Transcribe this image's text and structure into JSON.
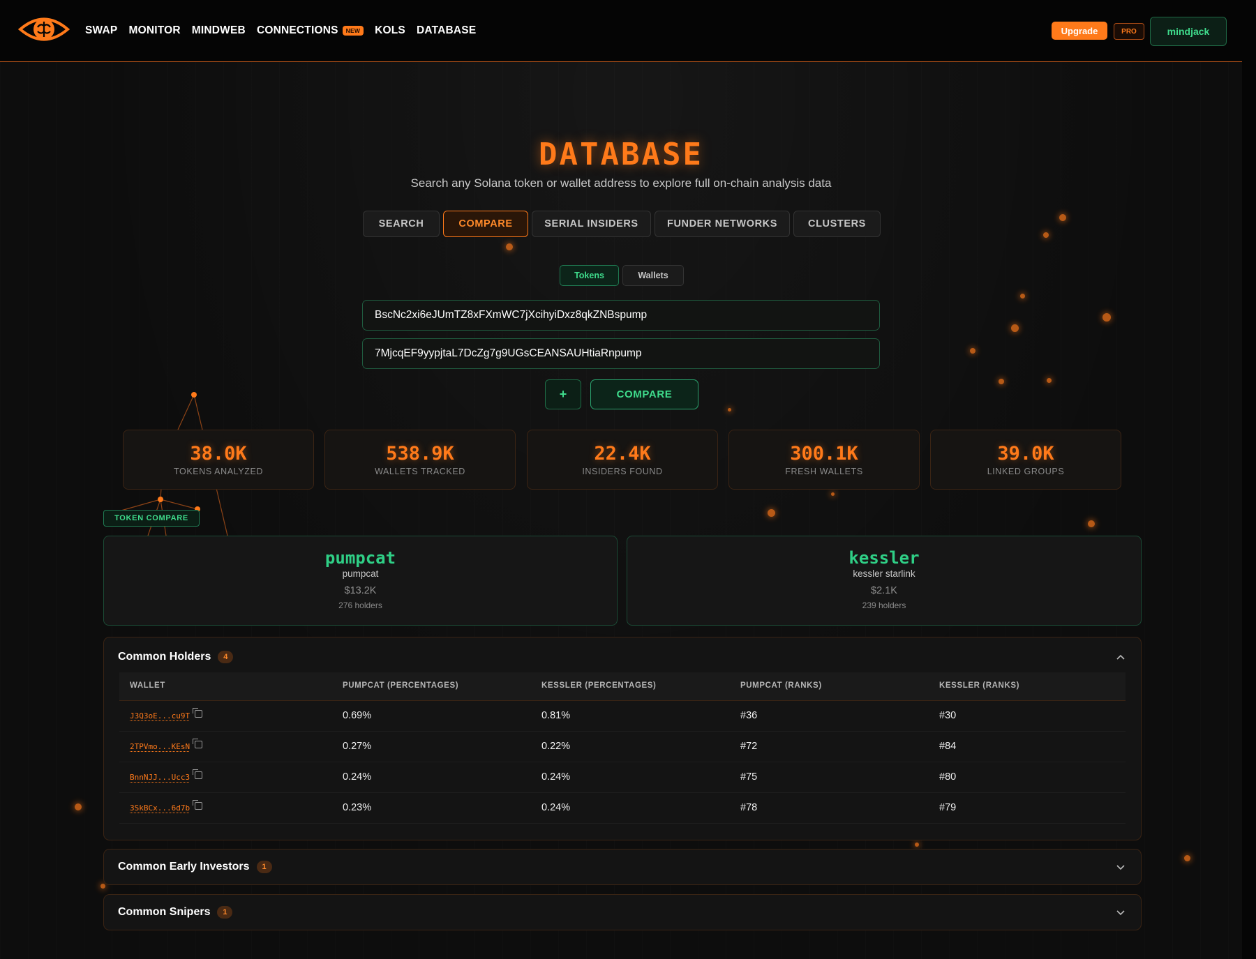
{
  "nav": {
    "links": [
      "SWAP",
      "MONITOR",
      "MINDWEB",
      "CONNECTIONS",
      "KOLS",
      "DATABASE"
    ],
    "new_badge": "NEW",
    "upgrade_label": "Upgrade",
    "pro_label": "PRO",
    "user_label": "mindjack"
  },
  "hero": {
    "title": "DATABASE",
    "subtitle": "Search any Solana token or wallet address to explore full on-chain analysis data"
  },
  "tabs": [
    "SEARCH",
    "COMPARE",
    "SERIAL INSIDERS",
    "FUNDER NETWORKS",
    "CLUSTERS"
  ],
  "active_tab": "COMPARE",
  "subtabs": [
    "Tokens",
    "Wallets"
  ],
  "active_subtab": "Tokens",
  "inputs": {
    "address_1": "BscNc2xi6eJUmTZ8xFXmWC7jXcihyiDxz8qkZNBspump",
    "address_2": "7MjcqEF9yypjtaL7DcZg7g9UGsCEANSAUHtiaRnpump"
  },
  "buttons": {
    "add": "+",
    "compare": "COMPARE"
  },
  "stats": [
    {
      "value": "38.0K",
      "label": "TOKENS ANALYZED"
    },
    {
      "value": "538.9K",
      "label": "WALLETS TRACKED"
    },
    {
      "value": "22.4K",
      "label": "INSIDERS FOUND"
    },
    {
      "value": "300.1K",
      "label": "FRESH WALLETS"
    },
    {
      "value": "39.0K",
      "label": "LINKED GROUPS"
    }
  ],
  "token_compare_label": "TOKEN COMPARE",
  "tokens": [
    {
      "symbol": "pumpcat",
      "name": "pumpcat",
      "price": "$13.2K",
      "holders": "276 holders"
    },
    {
      "symbol": "kessler",
      "name": "kessler starlink",
      "price": "$2.1K",
      "holders": "239 holders"
    }
  ],
  "common_holders": {
    "title": "Common Holders",
    "count": "4",
    "columns": [
      "WALLET",
      "PUMPCAT (PERCENTAGES)",
      "KESSLER (PERCENTAGES)",
      "PUMPCAT (RANKS)",
      "KESSLER (RANKS)"
    ],
    "rows": [
      [
        "J3Q3oE...cu9T",
        "0.69%",
        "0.81%",
        "#36",
        "#30"
      ],
      [
        "2TPVmo...KEsN",
        "0.27%",
        "0.22%",
        "#72",
        "#84"
      ],
      [
        "BnnNJJ...Ucc3",
        "0.24%",
        "0.24%",
        "#75",
        "#80"
      ],
      [
        "3SkBCx...6d7b",
        "0.23%",
        "0.24%",
        "#78",
        "#79"
      ]
    ]
  },
  "common_early_investors": {
    "title": "Common Early Investors",
    "count": "1"
  },
  "common_snipers": {
    "title": "Common Snipers",
    "count": "1"
  },
  "colors": {
    "accent_orange": "#ff7a1a",
    "accent_green": "#3fdc8c",
    "background": "#0d0d0d"
  }
}
